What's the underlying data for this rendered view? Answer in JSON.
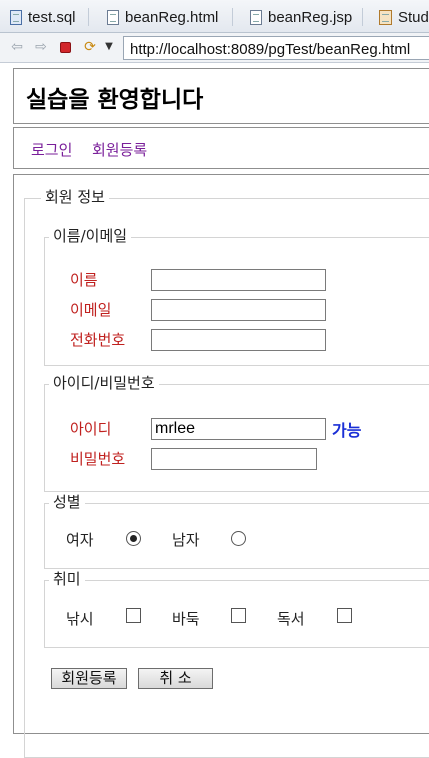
{
  "tabs": [
    {
      "label": "test.sql",
      "icon": "sql-file-icon"
    },
    {
      "label": "beanReg.html",
      "icon": "html-file-icon"
    },
    {
      "label": "beanReg.jsp",
      "icon": "jsp-file-icon"
    },
    {
      "label": "Stud",
      "icon": "java-file-icon"
    }
  ],
  "toolbar": {
    "back_icon": "back-arrow-icon",
    "forward_icon": "forward-arrow-icon",
    "stop_icon": "stop-icon",
    "refresh_icon": "refresh-icon",
    "url": "http://localhost:8089/pgTest/beanReg.html"
  },
  "page": {
    "title": "실습을 환영합니다",
    "nav": {
      "login": "로그인",
      "register": "회원등록"
    }
  },
  "form": {
    "legend": "회원 정보",
    "name_section": {
      "legend": "이름/이메일",
      "name_label": "이름",
      "email_label": "이메일",
      "phone_label": "전화번호",
      "name_value": "",
      "email_value": "",
      "phone_value": ""
    },
    "account_section": {
      "legend": "아이디/비밀번호",
      "id_label": "아이디",
      "id_value": "mrlee",
      "availability": "가능",
      "password_label": "비밀번호",
      "password_value": ""
    },
    "gender_section": {
      "legend": "성별",
      "female_label": "여자",
      "female_checked": true,
      "male_label": "남자",
      "male_checked": false
    },
    "hobby_section": {
      "legend": "취미",
      "fishing_label": "낚시",
      "baduk_label": "바둑",
      "reading_label": "독서",
      "fishing_checked": false,
      "baduk_checked": false,
      "reading_checked": false
    },
    "buttons": {
      "submit": "회원등록",
      "cancel": "취 소"
    }
  },
  "colors": {
    "label_red": "#c0211f",
    "link_purple": "#7a1f9a",
    "available_blue": "#1a2fd6"
  }
}
